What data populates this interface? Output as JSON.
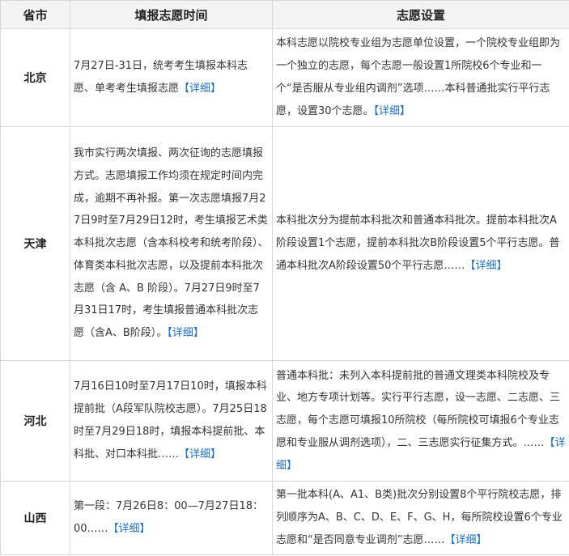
{
  "headers": {
    "province": "省市",
    "time": "填报志愿时间",
    "settings": "志愿设置"
  },
  "rows": [
    {
      "province": "北京",
      "time": "7月27日-31日，统考考生填报本科志愿、单考考生填报志愿",
      "time_more": "【详细】",
      "settings": "本科志愿以院校专业组为志愿单位设置，一个院校专业组即为一个独立的志愿，每个志愿一般设置1所院校6个专业和一个“是否服从专业组内调剂”选项……本科普通批实行平行志愿，设置30个志愿。",
      "settings_more": "【详细】"
    },
    {
      "province": "天津",
      "time": "我市实行两次填报、两次征询的志愿填报方式。志愿填报工作均须在规定时间内完成，逾期不再补报。第一次志愿填报7月27日9时至7月29日12时，考生填报艺术类本科批次志愿（含本科校考和统考阶段）、体育类本科批次志愿，以及提前本科批次志愿（含 A、B 阶段）。7月27日9时至7月31日17时，考生填报普通本科批次志愿（含A、B阶段）。",
      "time_more": "【详细】",
      "settings": "本科批次分为提前本科批次和普通本科批次。提前本科批次A阶段设置1个志愿，提前本科批次B阶段设置5个平行志愿。普通本科批次A阶段设置50个平行志愿……",
      "settings_more": "【详细】"
    },
    {
      "province": "河北",
      "time": "7月16日10时至7月17日10时，填报本科提前批（A段军队院校志愿）。7月25日18时至7月29日18时，填报本科提前批、本科批、对口本科批……",
      "time_more": "【详细】",
      "settings": "普通本科批：未列入本科提前批的普通文理类本科院校及专业、地方专项计划等。实行平行志愿，设一志愿、二志愿、三志愿，每个志愿可填报10所院校（每所院校可填报6个专业志愿和专业服从调剂选项），二、三志愿实行征集方式。……",
      "settings_more": "【详细】"
    },
    {
      "province": "山西",
      "time": "第一段：7月26日8：00—7月27日18：00……",
      "time_more": "【详细】",
      "settings": "第一批本科(A、A1、B类)批次分别设置8个平行院校志愿，排列顺序为A、B、C、D、E、F、G、H，每所院校设置6个专业志愿和“是否同意专业调剂”志愿……",
      "settings_more": "【详细】"
    }
  ]
}
